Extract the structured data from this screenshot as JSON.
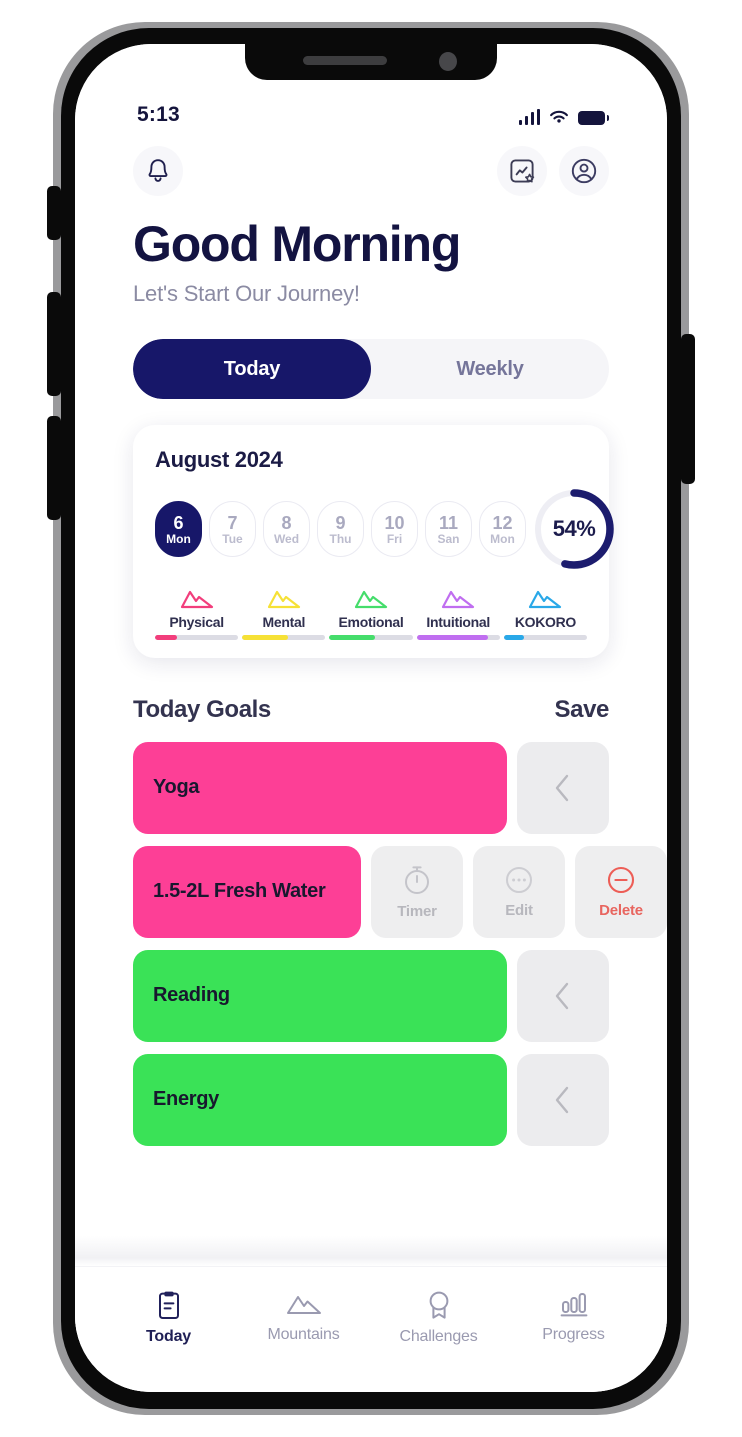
{
  "status_bar": {
    "time": "5:13",
    "signal_icon": "cellular-bars-icon",
    "wifi_icon": "wifi-icon",
    "battery_icon": "battery-full-icon"
  },
  "topbar": {
    "notifications_icon": "bell-icon",
    "insights_icon": "chart-star-icon",
    "profile_icon": "user-circle-icon"
  },
  "greeting": {
    "title": "Good Morning",
    "subtitle": "Let's Start Our Journey!"
  },
  "tabs": {
    "items": [
      {
        "label": "Today",
        "active": true
      },
      {
        "label": "Weekly",
        "active": false
      }
    ]
  },
  "calendar": {
    "month_label": "August 2024",
    "days": [
      {
        "num": "6",
        "name": "Mon",
        "selected": true
      },
      {
        "num": "7",
        "name": "Tue",
        "selected": false
      },
      {
        "num": "8",
        "name": "Wed",
        "selected": false
      },
      {
        "num": "9",
        "name": "Thu",
        "selected": false
      },
      {
        "num": "10",
        "name": "Fri",
        "selected": false
      },
      {
        "num": "11",
        "name": "San",
        "selected": false
      },
      {
        "num": "12",
        "name": "Mon",
        "selected": false
      }
    ],
    "progress_ring": {
      "label": "54%",
      "percent": 54,
      "arc_color": "#1c1c6e",
      "track_color": "#eeeef4"
    }
  },
  "categories": [
    {
      "name": "Physical",
      "color": "#f23e7c",
      "percent": 26,
      "icon": "mountain-icon"
    },
    {
      "name": "Mental",
      "color": "#f6e136",
      "percent": 55,
      "icon": "mountain-icon"
    },
    {
      "name": "Emotional",
      "color": "#45dd6b",
      "percent": 55,
      "icon": "mountain-icon"
    },
    {
      "name": "Intuitional",
      "color": "#c06ef0",
      "percent": 86,
      "icon": "mountain-icon"
    },
    {
      "name": "KOKORO",
      "color": "#29a8e8",
      "percent": 24,
      "icon": "mountain-icon"
    }
  ],
  "goals_section": {
    "title": "Today Goals",
    "save_label": "Save",
    "items": [
      {
        "label": "Yoga",
        "color": "#fd3f96",
        "state": "collapsed",
        "chevron_icon": "chevron-left-icon"
      },
      {
        "label": "1.5-2L Fresh Water",
        "color": "#fd3f96",
        "state": "open",
        "actions": [
          {
            "label": "Timer",
            "icon": "stopwatch-icon",
            "color": "#b7b7bd"
          },
          {
            "label": "Edit",
            "icon": "ellipsis-circle-icon",
            "color": "#b7b7bd"
          },
          {
            "label": "Delete",
            "icon": "minus-circle-icon",
            "color": "#e8655f"
          }
        ]
      },
      {
        "label": "Reading",
        "color": "#3ae257",
        "state": "collapsed",
        "chevron_icon": "chevron-left-icon"
      },
      {
        "label": "Energy",
        "color": "#3ae257",
        "state": "collapsed",
        "chevron_icon": "chevron-left-icon"
      }
    ]
  },
  "bottom_nav": {
    "items": [
      {
        "label": "Today",
        "icon": "clipboard-icon",
        "active": true
      },
      {
        "label": "Mountains",
        "icon": "mountain-icon",
        "active": false
      },
      {
        "label": "Challenges",
        "icon": "medal-icon",
        "active": false
      },
      {
        "label": "Progress",
        "icon": "bar-chart-icon",
        "active": false
      }
    ]
  },
  "theme": {
    "navy": "#171769",
    "pink": "#fd3f96",
    "green": "#3ae257",
    "muted": "#9a9ab0"
  }
}
